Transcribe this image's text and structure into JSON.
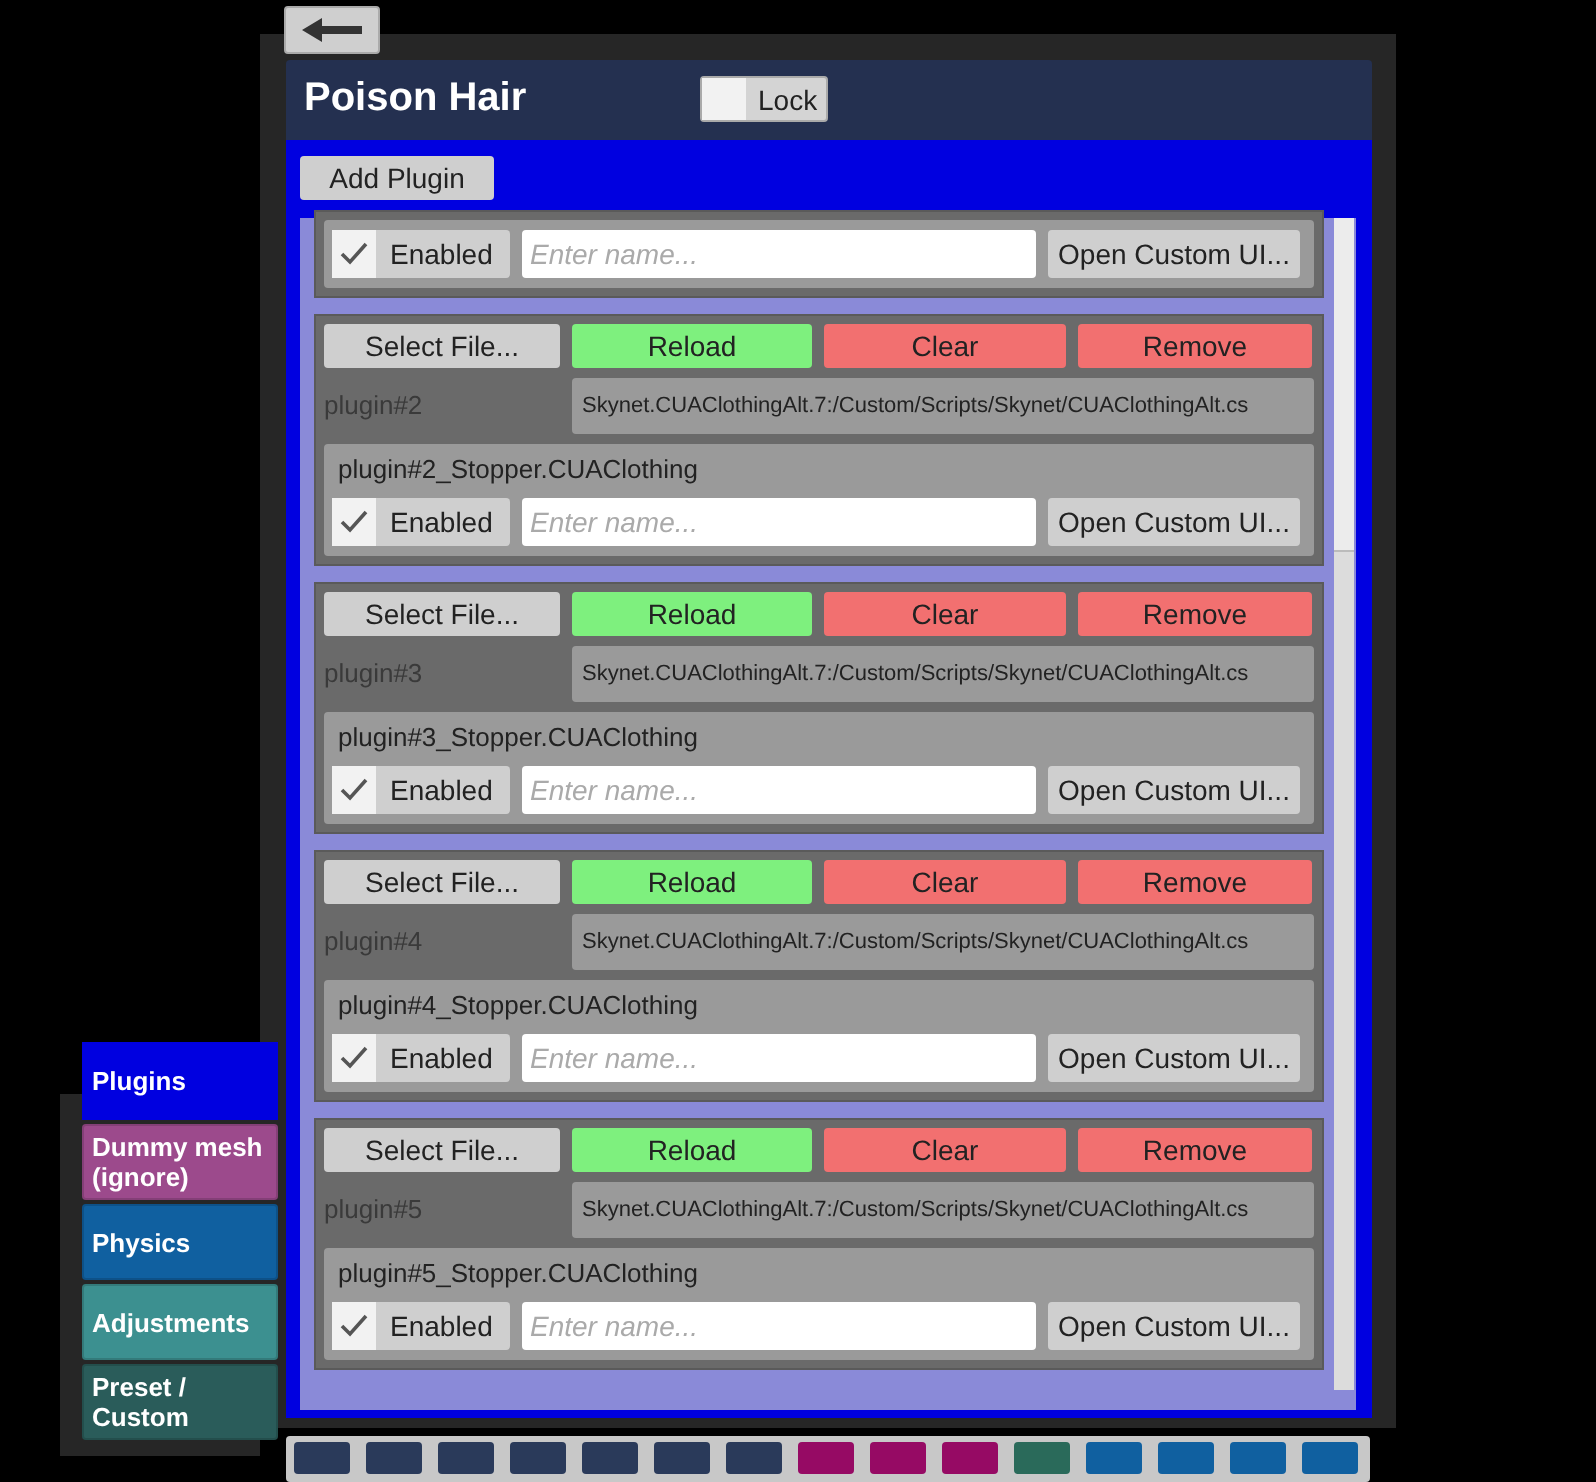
{
  "window": {
    "title": "Poison Hair",
    "lock": {
      "label": "Lock",
      "checked": false
    }
  },
  "add_button": "Add Plugin",
  "plugins": [
    {
      "kind": "partial",
      "enabled": {
        "label": "Enabled",
        "checked": true
      },
      "name_placeholder": "Enter name...",
      "open_button": "Open Custom UI..."
    },
    {
      "kind": "full",
      "select_button": "Select File...",
      "reload_button": "Reload",
      "clear_button": "Clear",
      "remove_button": "Remove",
      "label": "plugin#2",
      "path": "Skynet.CUAClothingAlt.7:/Custom/Scripts/Skynet/CUAClothingAlt.cs",
      "instance": "plugin#2_Stopper.CUAClothing",
      "enabled": {
        "label": "Enabled",
        "checked": true
      },
      "name_placeholder": "Enter name...",
      "open_button": "Open Custom UI..."
    },
    {
      "kind": "full",
      "select_button": "Select File...",
      "reload_button": "Reload",
      "clear_button": "Clear",
      "remove_button": "Remove",
      "label": "plugin#3",
      "path": "Skynet.CUAClothingAlt.7:/Custom/Scripts/Skynet/CUAClothingAlt.cs",
      "instance": "plugin#3_Stopper.CUAClothing",
      "enabled": {
        "label": "Enabled",
        "checked": true
      },
      "name_placeholder": "Enter name...",
      "open_button": "Open Custom UI..."
    },
    {
      "kind": "full",
      "select_button": "Select File...",
      "reload_button": "Reload",
      "clear_button": "Clear",
      "remove_button": "Remove",
      "label": "plugin#4",
      "path": "Skynet.CUAClothingAlt.7:/Custom/Scripts/Skynet/CUAClothingAlt.cs",
      "instance": "plugin#4_Stopper.CUAClothing",
      "enabled": {
        "label": "Enabled",
        "checked": true
      },
      "name_placeholder": "Enter name...",
      "open_button": "Open Custom UI..."
    },
    {
      "kind": "full",
      "select_button": "Select File...",
      "reload_button": "Reload",
      "clear_button": "Clear",
      "remove_button": "Remove",
      "label": "plugin#5",
      "path": "Skynet.CUAClothingAlt.7:/Custom/Scripts/Skynet/CUAClothingAlt.cs",
      "instance": "plugin#5_Stopper.CUAClothing",
      "enabled": {
        "label": "Enabled",
        "checked": true
      },
      "name_placeholder": "Enter name...",
      "open_button": "Open Custom UI..."
    }
  ],
  "tabs": [
    {
      "label": "Plugins",
      "selected": true,
      "color": "#0000e0"
    },
    {
      "label": "Dummy mesh (ignore)",
      "selected": false,
      "color": "#9c4a8c"
    },
    {
      "label": "Physics",
      "selected": false,
      "color": "#1060a0"
    },
    {
      "label": "Adjustments",
      "selected": false,
      "color": "#3c9090"
    },
    {
      "label": "Preset / Custom",
      "selected": false,
      "color": "#2a5c5a"
    }
  ],
  "toolbar": [
    {
      "color": "#2a3a5a"
    },
    {
      "color": "#2a3a5a"
    },
    {
      "color": "#2a3a5a"
    },
    {
      "color": "#2a3a5a"
    },
    {
      "color": "#2a3a5a"
    },
    {
      "color": "#2a3a5a"
    },
    {
      "color": "#2a3a5a"
    },
    {
      "color": "#960a64"
    },
    {
      "color": "#960a64"
    },
    {
      "color": "#960a64"
    },
    {
      "color": "#2a6a5a"
    },
    {
      "color": "#1060a0"
    },
    {
      "color": "#1060a0"
    },
    {
      "color": "#1060a0"
    },
    {
      "color": "#1060a0"
    }
  ]
}
